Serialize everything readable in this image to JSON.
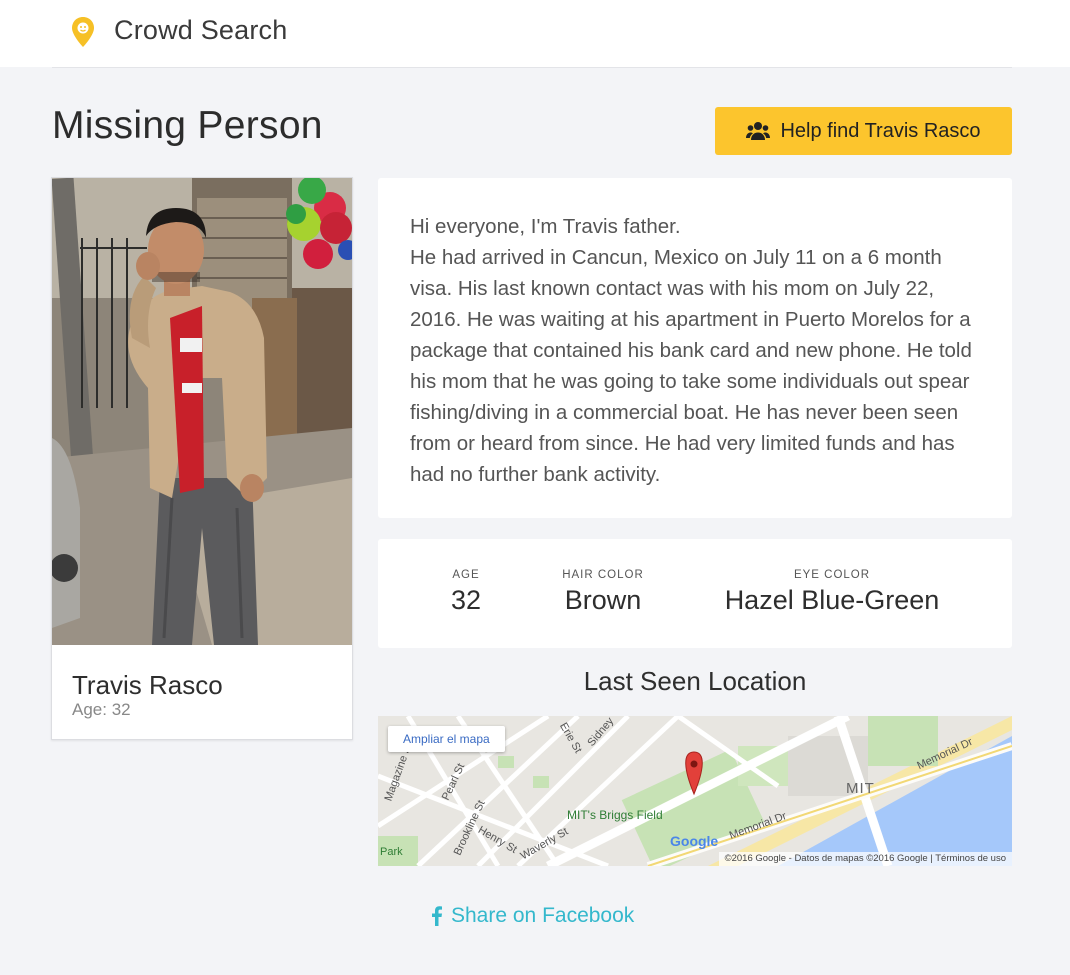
{
  "header": {
    "brand": "Crowd Search",
    "logo_icon": "location-pin-icon"
  },
  "page": {
    "title": "Missing Person"
  },
  "help_button": {
    "label": "Help find Travis Rasco",
    "icon": "group-icon",
    "color": "#fcc52d"
  },
  "profile": {
    "name": "Travis Rasco",
    "age_text": "Age: 32"
  },
  "story": {
    "paragraphs": [
      "Hi everyone, I'm Travis father.",
      "He had arrived in Cancun, Mexico on July 11 on a 6 month visa. His last known contact was with his mom on July 22, 2016. He was waiting at his apartment in Puerto Morelos for a package that contained his bank card and new phone. He told his mom that he was going to take some individuals out spear fishing/diving in a commercial boat. He has never been seen from or heard from since. He had very limited funds and has had no further bank activity."
    ]
  },
  "stats": [
    {
      "label": "AGE",
      "value": "32"
    },
    {
      "label": "HAIR COLOR",
      "value": "Brown"
    },
    {
      "label": "EYE COLOR",
      "value": "Hazel Blue-Green"
    }
  ],
  "location": {
    "title": "Last Seen Location",
    "enlarge_label": "Ampliar el mapa",
    "attribution": "©2016 Google - Datos de mapas ©2016 Google  |  Términos de uso",
    "labels": {
      "briggs": "MIT's Briggs Field",
      "mit": "MIT",
      "memorial1": "Memorial Dr",
      "memorial2": "Memorial Dr",
      "pearl": "Pearl St",
      "brookline": "Brookline St",
      "henry": "Henry St",
      "waverly": "Waverly St",
      "erie": "Erie St",
      "sidney": "Sidney",
      "magazine": "Magazine St",
      "park": "Park",
      "google": "Google"
    }
  },
  "share": {
    "label": "Share on Facebook",
    "icon": "facebook-icon",
    "color": "#34b8cc"
  }
}
